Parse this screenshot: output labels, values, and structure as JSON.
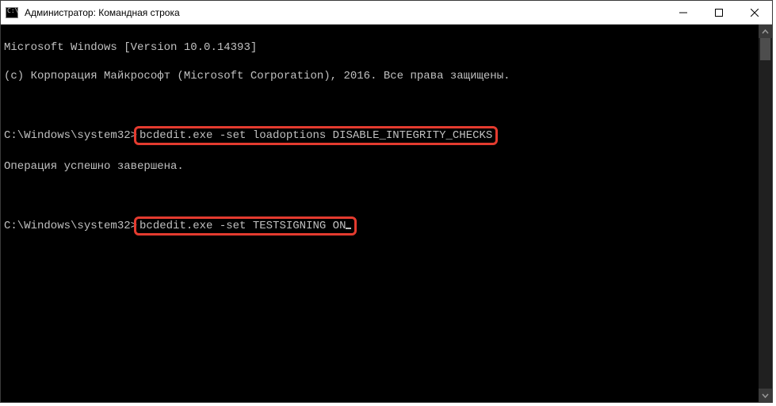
{
  "window": {
    "title": "Администратор: Командная строка"
  },
  "console": {
    "header_line": "Microsoft Windows [Version 10.0.14393]",
    "copyright_line": "(c) Корпорация Майкрософт (Microsoft Corporation), 2016. Все права защищены.",
    "prompt1_prefix": "C:\\Windows\\system32>",
    "command1": "bcdedit.exe -set loadoptions DISABLE_INTEGRITY_CHECKS",
    "result1": "Операция успешно завершена.",
    "prompt2_prefix": "C:\\Windows\\system32>",
    "command2": "bcdedit.exe -set TESTSIGNING ON"
  }
}
